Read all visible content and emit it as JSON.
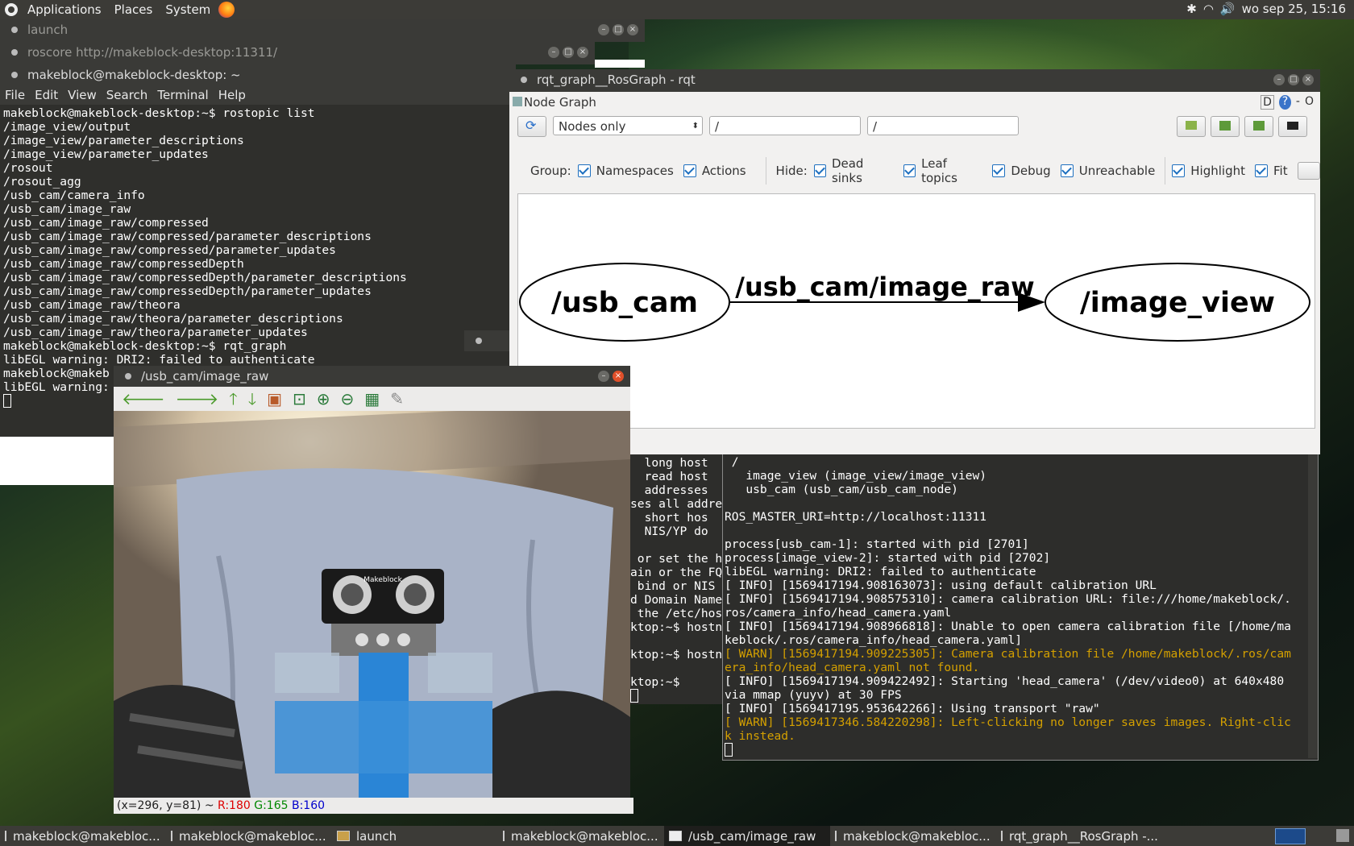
{
  "top_panel": {
    "menus": [
      "Applications",
      "Places",
      "System"
    ],
    "clock": "wo sep 25, 15:16"
  },
  "windows": {
    "launch_title": "launch",
    "roscore_title": "roscore http://makeblock-desktop:11311/",
    "terminal_title": "makeblock@makeblock-desktop: ~",
    "terminal_menu": [
      "File",
      "Edit",
      "View",
      "Search",
      "Terminal",
      "Help"
    ],
    "terminal_lines": [
      "makeblock@makeblock-desktop:~$ rostopic list",
      "/image_view/output",
      "/image_view/parameter_descriptions",
      "/image_view/parameter_updates",
      "/rosout",
      "/rosout_agg",
      "/usb_cam/camera_info",
      "/usb_cam/image_raw",
      "/usb_cam/image_raw/compressed",
      "/usb_cam/image_raw/compressed/parameter_descriptions",
      "/usb_cam/image_raw/compressed/parameter_updates",
      "/usb_cam/image_raw/compressedDepth",
      "/usb_cam/image_raw/compressedDepth/parameter_descriptions",
      "/usb_cam/image_raw/compressedDepth/parameter_updates",
      "/usb_cam/image_raw/theora",
      "/usb_cam/image_raw/theora/parameter_descriptions",
      "/usb_cam/image_raw/theora/parameter_updates",
      "makeblock@makeblock-desktop:~$ rqt_graph",
      "libEGL warning: DRI2: failed to authenticate",
      "makeblock@makeb",
      "libEGL warning:"
    ],
    "mid_term_lines": [
      "  long host",
      "  read host",
      "  addresses",
      "ses all addre",
      "  short hos",
      "  NIS/YP do",
      "",
      " or set the h",
      "ain or the FQ",
      " bind or NIS",
      "d Domain Name",
      " the /etc/hos",
      "ktop:~$ hostn",
      "",
      "ktop:~$ hostn",
      "",
      "ktop:~$ "
    ],
    "launch_lines": [
      {
        "t": " /",
        "w": false
      },
      {
        "t": "   image_view (image_view/image_view)",
        "w": false
      },
      {
        "t": "   usb_cam (usb_cam/usb_cam_node)",
        "w": false
      },
      {
        "t": "",
        "w": false
      },
      {
        "t": "ROS_MASTER_URI=http://localhost:11311",
        "w": false
      },
      {
        "t": "",
        "w": false
      },
      {
        "t": "process[usb_cam-1]: started with pid [2701]",
        "w": false
      },
      {
        "t": "process[image_view-2]: started with pid [2702]",
        "w": false
      },
      {
        "t": "libEGL warning: DRI2: failed to authenticate",
        "w": false
      },
      {
        "t": "[ INFO] [1569417194.908163073]: using default calibration URL",
        "w": false
      },
      {
        "t": "[ INFO] [1569417194.908575310]: camera calibration URL: file:///home/makeblock/.",
        "w": false
      },
      {
        "t": "ros/camera_info/head_camera.yaml",
        "w": false
      },
      {
        "t": "[ INFO] [1569417194.908966818]: Unable to open camera calibration file [/home/ma",
        "w": false
      },
      {
        "t": "keblock/.ros/camera_info/head_camera.yaml]",
        "w": false
      },
      {
        "t": "[ WARN] [1569417194.909225305]: Camera calibration file /home/makeblock/.ros/cam",
        "w": true
      },
      {
        "t": "era_info/head_camera.yaml not found.",
        "w": true
      },
      {
        "t": "[ INFO] [1569417194.909422492]: Starting 'head_camera' (/dev/video0) at 640x480",
        "w": false
      },
      {
        "t": "via mmap (yuyv) at 30 FPS",
        "w": false
      },
      {
        "t": "[ INFO] [1569417195.953642266]: Using transport \"raw\"",
        "w": false
      },
      {
        "t": "[ WARN] [1569417346.584220298]: Left-clicking no longer saves images. Right-clic",
        "w": true
      },
      {
        "t": "k instead.",
        "w": true
      }
    ]
  },
  "rqt": {
    "title": "rqt_graph__RosGraph - rqt",
    "plugin": "Node Graph",
    "plugin_right": "D",
    "plugin_help": "?",
    "plugin_min": "-",
    "plugin_close": "O",
    "combo": "Nodes only",
    "filter1": "/",
    "filter2": "/",
    "group_label": "Group:",
    "hide_label": "Hide:",
    "checks_group": [
      "Namespaces",
      "Actions"
    ],
    "checks_hide": [
      "Dead sinks",
      "Leaf topics",
      "Debug",
      "Unreachable"
    ],
    "checks_right": [
      "Highlight",
      "Fit"
    ],
    "node_left": "/usb_cam",
    "node_right": "/image_view",
    "edge_label": "/usb_cam/image_raw"
  },
  "image_view": {
    "title": "/usb_cam/image_raw",
    "status_pos": "(x=296, y=81) ~ ",
    "status_r": "R:180",
    "status_g": "G:165",
    "status_b": "B:160",
    "logo": "Makeblock"
  },
  "taskbar": [
    "makeblock@makebloc...",
    "makeblock@makebloc...",
    "launch",
    "makeblock@makebloc...",
    "/usb_cam/image_raw",
    "makeblock@makebloc...",
    "rqt_graph__RosGraph -..."
  ]
}
